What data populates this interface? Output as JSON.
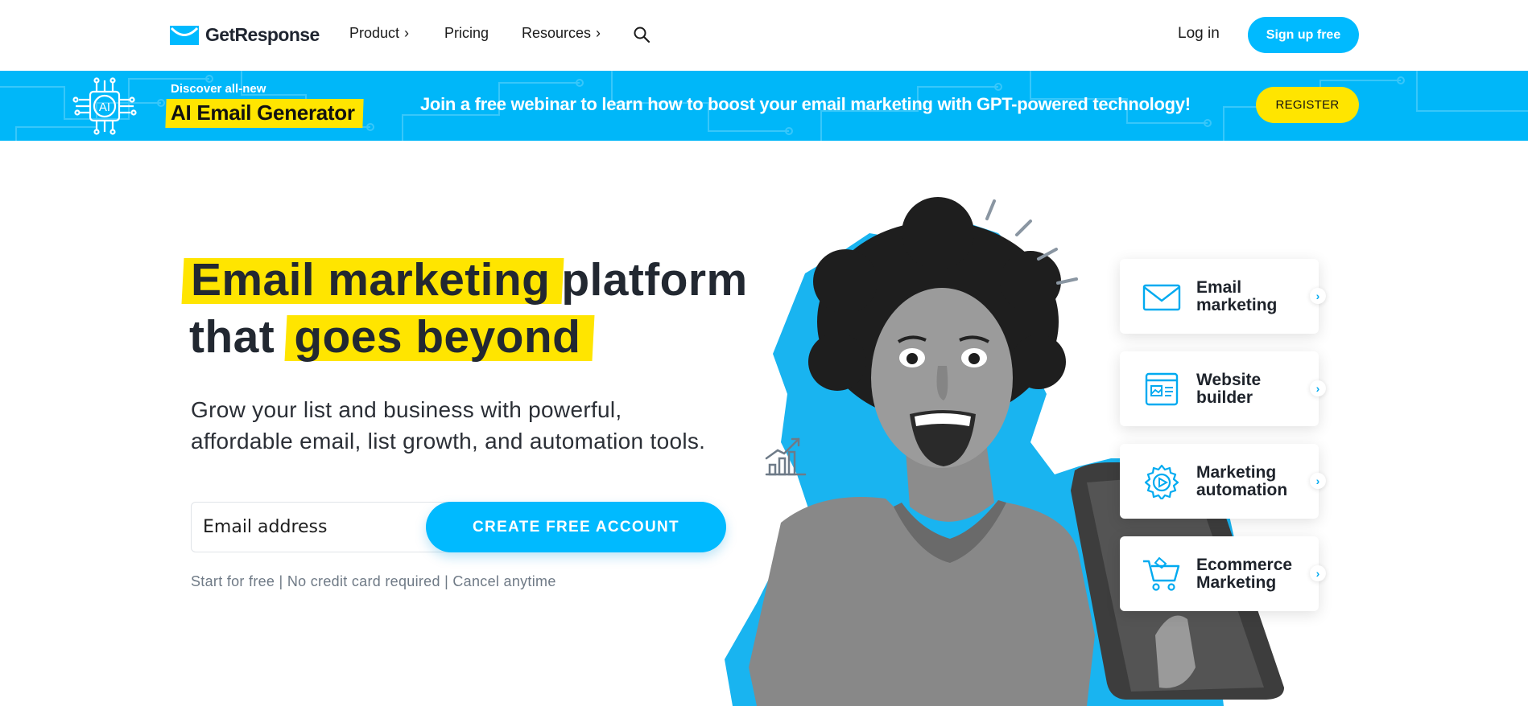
{
  "nav": {
    "logo_text": "GetResponse",
    "items": [
      {
        "label": "Product",
        "chevron": "›"
      },
      {
        "label": "Pricing"
      },
      {
        "label": "Resources",
        "chevron": "›"
      }
    ],
    "search_icon": "search-icon",
    "login_label": "Log in",
    "signup_label": "Sign up free"
  },
  "banner": {
    "discover": "Discover all-new",
    "product": "AI Email Generator",
    "chip_text": "AI",
    "message": "Join a free webinar to learn how to boost your email marketing with GPT-powered technology!",
    "register_label": "REGISTER"
  },
  "hero": {
    "headline": {
      "line1_highlight": "Email marketing",
      "line1_rest": "platform",
      "line2_lead": "that",
      "line2_highlight": "goes beyond"
    },
    "subtext_line1": "Grow your list and business with  powerful,",
    "subtext_line2": "affordable email, list growth, and automation tools.",
    "email_placeholder": "Email address",
    "cta_label": "CREATE FREE ACCOUNT",
    "note": "Start for free | No credit card required | Cancel anytime"
  },
  "features": [
    {
      "line1": "Email",
      "line2": "marketing",
      "icon": "envelope-icon"
    },
    {
      "line1": "Website",
      "line2": "builder",
      "icon": "website-icon"
    },
    {
      "line1": "Marketing",
      "line2": "automation",
      "icon": "gear-play-icon"
    },
    {
      "line1": "Ecommerce",
      "line2": "Marketing",
      "icon": "cart-icon"
    }
  ],
  "colors": {
    "accent": "#00baff",
    "highlight": "#ffe500",
    "text": "#222831"
  }
}
